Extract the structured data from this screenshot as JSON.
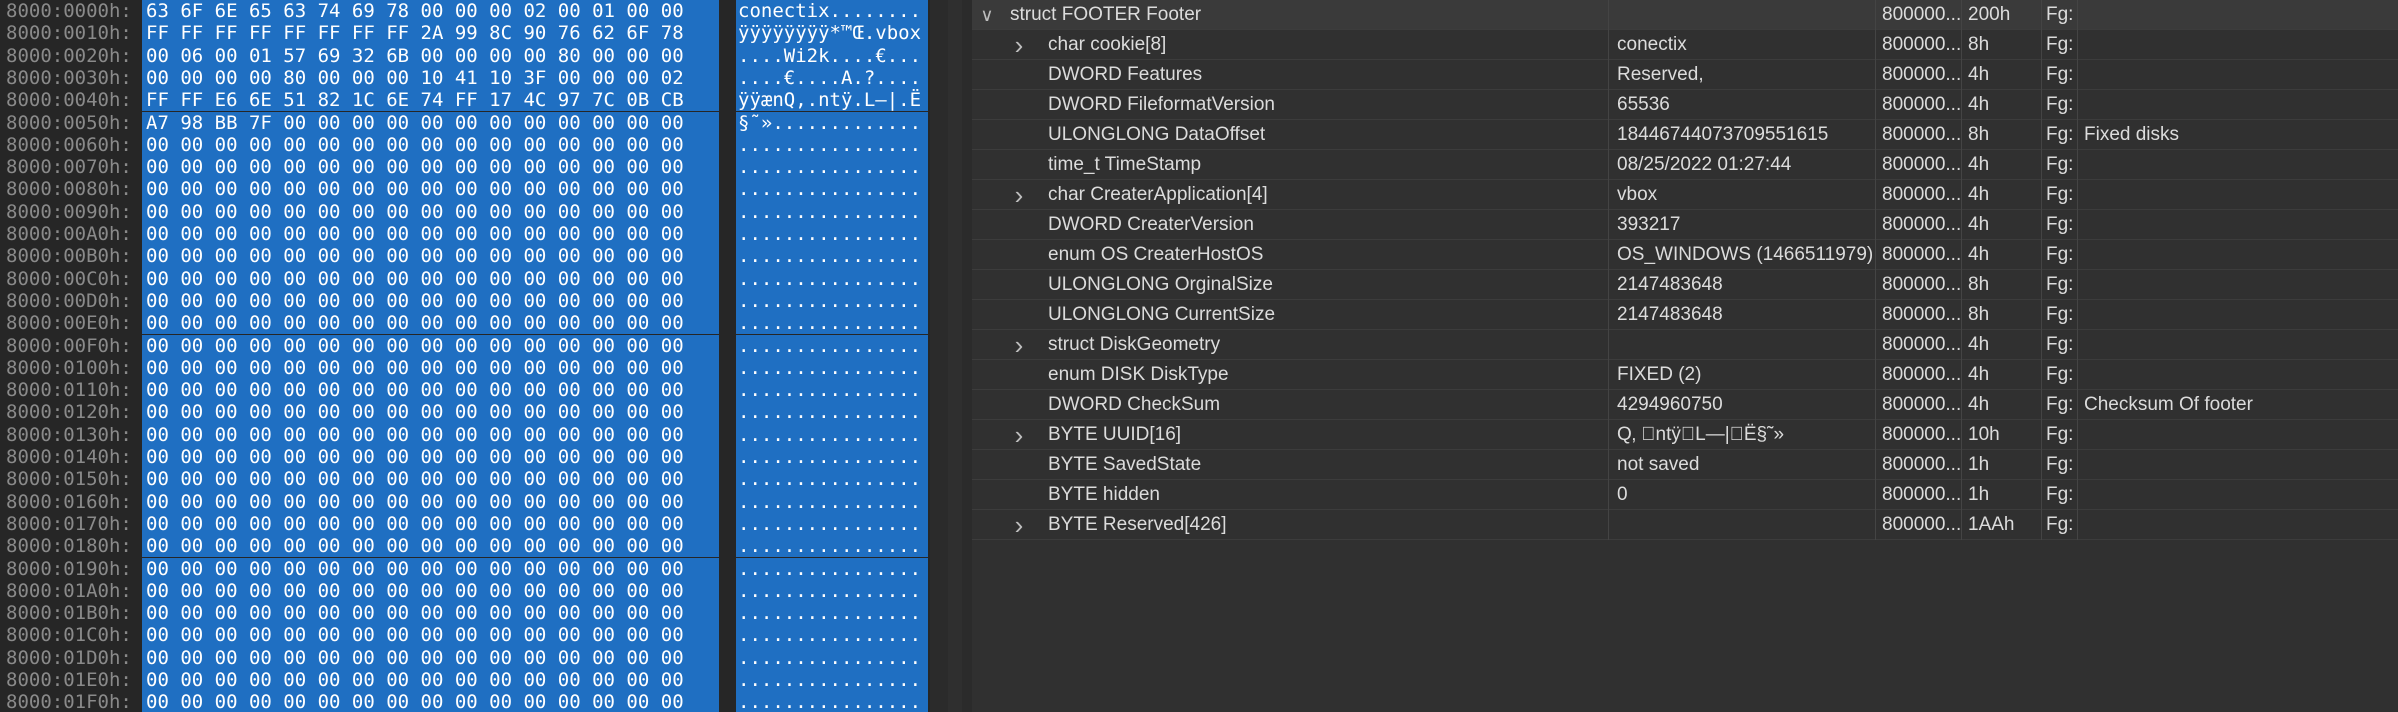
{
  "hex": {
    "rows": [
      {
        "offset": "8000:0000h:",
        "bytes": "63 6F 6E 65 63 74 69 78 00 00 00 02 00 01 00 00",
        "ascii": "conectix........"
      },
      {
        "offset": "8000:0010h:",
        "bytes": "FF FF FF FF FF FF FF FF 2A 99 8C 90 76 62 6F 78",
        "ascii": "ÿÿÿÿÿÿÿÿ*™Œ.vbox"
      },
      {
        "offset": "8000:0020h:",
        "bytes": "00 06 00 01 57 69 32 6B 00 00 00 00 80 00 00 00",
        "ascii": "....Wi2k....€..."
      },
      {
        "offset": "8000:0030h:",
        "bytes": "00 00 00 00 80 00 00 00 10 41 10 3F 00 00 00 02",
        "ascii": "....€....A.?...."
      },
      {
        "offset": "8000:0040h:",
        "bytes": "FF FF E6 6E 51 82 1C 6E 74 FF 17 4C 97 7C 0B CB",
        "ascii": "ÿÿænQ‚.ntÿ.L—|.Ë"
      },
      {
        "offset": "8000:0050h:",
        "bytes": "A7 98 BB 7F 00 00 00 00 00 00 00 00 00 00 00 00",
        "ascii": "§˜»............."
      },
      {
        "offset": "8000:0060h:",
        "bytes": "00 00 00 00 00 00 00 00 00 00 00 00 00 00 00 00",
        "ascii": "................"
      },
      {
        "offset": "8000:0070h:",
        "bytes": "00 00 00 00 00 00 00 00 00 00 00 00 00 00 00 00",
        "ascii": "................"
      },
      {
        "offset": "8000:0080h:",
        "bytes": "00 00 00 00 00 00 00 00 00 00 00 00 00 00 00 00",
        "ascii": "................"
      },
      {
        "offset": "8000:0090h:",
        "bytes": "00 00 00 00 00 00 00 00 00 00 00 00 00 00 00 00",
        "ascii": "................"
      },
      {
        "offset": "8000:00A0h:",
        "bytes": "00 00 00 00 00 00 00 00 00 00 00 00 00 00 00 00",
        "ascii": "................"
      },
      {
        "offset": "8000:00B0h:",
        "bytes": "00 00 00 00 00 00 00 00 00 00 00 00 00 00 00 00",
        "ascii": "................"
      },
      {
        "offset": "8000:00C0h:",
        "bytes": "00 00 00 00 00 00 00 00 00 00 00 00 00 00 00 00",
        "ascii": "................"
      },
      {
        "offset": "8000:00D0h:",
        "bytes": "00 00 00 00 00 00 00 00 00 00 00 00 00 00 00 00",
        "ascii": "................"
      },
      {
        "offset": "8000:00E0h:",
        "bytes": "00 00 00 00 00 00 00 00 00 00 00 00 00 00 00 00",
        "ascii": "................"
      },
      {
        "offset": "8000:00F0h:",
        "bytes": "00 00 00 00 00 00 00 00 00 00 00 00 00 00 00 00",
        "ascii": "................"
      },
      {
        "offset": "8000:0100h:",
        "bytes": "00 00 00 00 00 00 00 00 00 00 00 00 00 00 00 00",
        "ascii": "................"
      },
      {
        "offset": "8000:0110h:",
        "bytes": "00 00 00 00 00 00 00 00 00 00 00 00 00 00 00 00",
        "ascii": "................"
      },
      {
        "offset": "8000:0120h:",
        "bytes": "00 00 00 00 00 00 00 00 00 00 00 00 00 00 00 00",
        "ascii": "................"
      },
      {
        "offset": "8000:0130h:",
        "bytes": "00 00 00 00 00 00 00 00 00 00 00 00 00 00 00 00",
        "ascii": "................"
      },
      {
        "offset": "8000:0140h:",
        "bytes": "00 00 00 00 00 00 00 00 00 00 00 00 00 00 00 00",
        "ascii": "................"
      },
      {
        "offset": "8000:0150h:",
        "bytes": "00 00 00 00 00 00 00 00 00 00 00 00 00 00 00 00",
        "ascii": "................"
      },
      {
        "offset": "8000:0160h:",
        "bytes": "00 00 00 00 00 00 00 00 00 00 00 00 00 00 00 00",
        "ascii": "................"
      },
      {
        "offset": "8000:0170h:",
        "bytes": "00 00 00 00 00 00 00 00 00 00 00 00 00 00 00 00",
        "ascii": "................"
      },
      {
        "offset": "8000:0180h:",
        "bytes": "00 00 00 00 00 00 00 00 00 00 00 00 00 00 00 00",
        "ascii": "................"
      },
      {
        "offset": "8000:0190h:",
        "bytes": "00 00 00 00 00 00 00 00 00 00 00 00 00 00 00 00",
        "ascii": "................"
      },
      {
        "offset": "8000:01A0h:",
        "bytes": "00 00 00 00 00 00 00 00 00 00 00 00 00 00 00 00",
        "ascii": "................"
      },
      {
        "offset": "8000:01B0h:",
        "bytes": "00 00 00 00 00 00 00 00 00 00 00 00 00 00 00 00",
        "ascii": "................"
      },
      {
        "offset": "8000:01C0h:",
        "bytes": "00 00 00 00 00 00 00 00 00 00 00 00 00 00 00 00",
        "ascii": "................"
      },
      {
        "offset": "8000:01D0h:",
        "bytes": "00 00 00 00 00 00 00 00 00 00 00 00 00 00 00 00",
        "ascii": "................"
      },
      {
        "offset": "8000:01E0h:",
        "bytes": "00 00 00 00 00 00 00 00 00 00 00 00 00 00 00 00",
        "ascii": "................"
      },
      {
        "offset": "8000:01F0h:",
        "bytes": "00 00 00 00 00 00 00 00 00 00 00 00 00 00 00 00",
        "ascii": "................"
      }
    ]
  },
  "template": {
    "rows": [
      {
        "name": "struct FOOTER Footer",
        "value": "",
        "start": "800000...",
        "size": "200h",
        "color": "Fg:",
        "comment": "",
        "expander": "expanded",
        "header": true
      },
      {
        "name": "char cookie[8]",
        "value": "conectix",
        "start": "800000...",
        "size": "8h",
        "color": "Fg:",
        "comment": "",
        "expander": "collapsed"
      },
      {
        "name": "DWORD Features",
        "value": "Reserved,",
        "start": "800000...",
        "size": "4h",
        "color": "Fg:",
        "comment": "",
        "expander": "none"
      },
      {
        "name": "DWORD FileformatVersion",
        "value": "65536",
        "start": "800000...",
        "size": "4h",
        "color": "Fg:",
        "comment": "",
        "expander": "none"
      },
      {
        "name": "ULONGLONG DataOffset",
        "value": "18446744073709551615",
        "start": "800000...",
        "size": "8h",
        "color": "Fg:",
        "comment": "Fixed disks",
        "expander": "none"
      },
      {
        "name": "time_t TimeStamp",
        "value": "08/25/2022 01:27:44",
        "start": "800000...",
        "size": "4h",
        "color": "Fg:",
        "comment": "",
        "expander": "none"
      },
      {
        "name": "char CreaterApplication[4]",
        "value": "vbox",
        "start": "800000...",
        "size": "4h",
        "color": "Fg:",
        "comment": "",
        "expander": "collapsed"
      },
      {
        "name": "DWORD CreaterVersion",
        "value": "393217",
        "start": "800000...",
        "size": "4h",
        "color": "Fg:",
        "comment": "",
        "expander": "none"
      },
      {
        "name": "enum OS CreaterHostOS",
        "value": "OS_WINDOWS (1466511979)",
        "start": "800000...",
        "size": "4h",
        "color": "Fg:",
        "comment": "",
        "expander": "none"
      },
      {
        "name": "ULONGLONG OrginalSize",
        "value": "2147483648",
        "start": "800000...",
        "size": "8h",
        "color": "Fg:",
        "comment": "",
        "expander": "none"
      },
      {
        "name": "ULONGLONG CurrentSize",
        "value": "2147483648",
        "start": "800000...",
        "size": "8h",
        "color": "Fg:",
        "comment": "",
        "expander": "none"
      },
      {
        "name": "struct DiskGeometry",
        "value": "",
        "start": "800000...",
        "size": "4h",
        "color": "Fg:",
        "comment": "",
        "expander": "collapsed"
      },
      {
        "name": "enum DISK DiskType",
        "value": "FIXED (2)",
        "start": "800000...",
        "size": "4h",
        "color": "Fg:",
        "comment": "",
        "expander": "none"
      },
      {
        "name": "DWORD CheckSum",
        "value": "4294960750",
        "start": "800000...",
        "size": "4h",
        "color": "Fg:",
        "comment": "Checksum Of footer",
        "expander": "none"
      },
      {
        "name": "BYTE UUID[16]",
        "value": "Q‚ \u0000ntÿ\u0000L—|\u0000Ë§˜»",
        "start": "800000...",
        "size": "10h",
        "color": "Fg:",
        "comment": "",
        "expander": "collapsed"
      },
      {
        "name": "BYTE SavedState",
        "value": "not saved",
        "start": "800000...",
        "size": "1h",
        "color": "Fg:",
        "comment": "",
        "expander": "none"
      },
      {
        "name": "BYTE hidden",
        "value": "0",
        "start": "800000...",
        "size": "1h",
        "color": "Fg:",
        "comment": "",
        "expander": "none"
      },
      {
        "name": "BYTE Reserved[426]",
        "value": "",
        "start": "800000...",
        "size": "1AAh",
        "color": "Fg:",
        "comment": "",
        "expander": "collapsed"
      }
    ]
  },
  "icons": {
    "expanded": "chevron-down-icon",
    "collapsed": "chevron-right-icon"
  },
  "colors": {
    "selection": "#1f6fc2",
    "background": "#303030",
    "text": "#dcdcdc"
  }
}
